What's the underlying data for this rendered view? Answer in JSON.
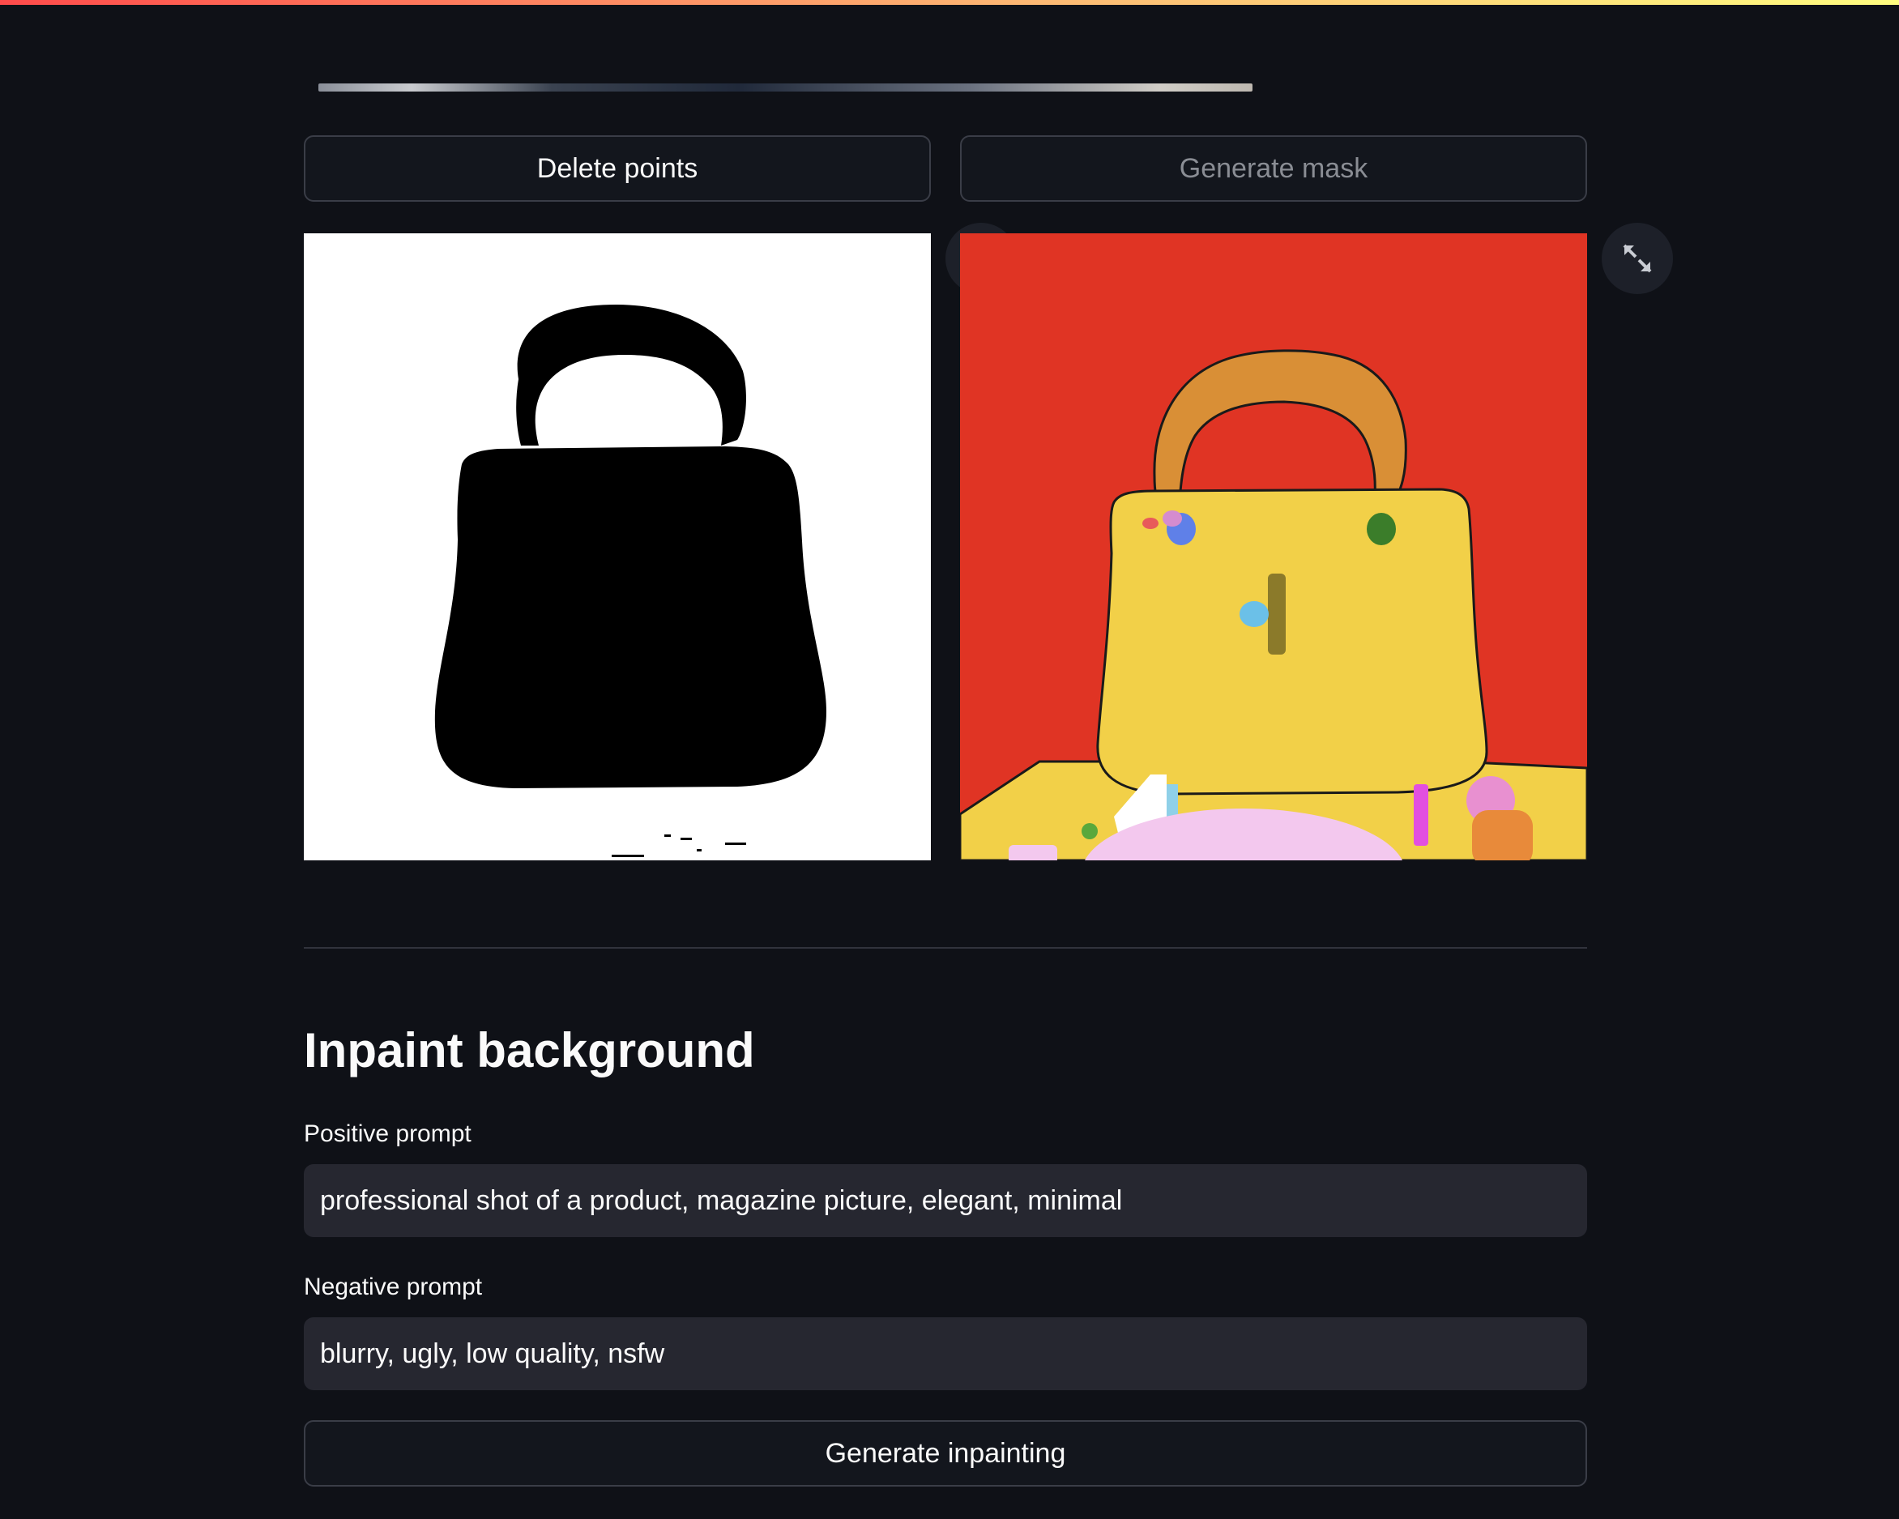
{
  "buttons": {
    "delete_points": "Delete points",
    "generate_mask": "Generate mask",
    "generate_inpainting": "Generate inpainting"
  },
  "images": {
    "mask": {
      "description": "black handbag silhouette mask"
    },
    "segmentation": {
      "description": "colored segmentation map"
    }
  },
  "inpaint": {
    "title": "Inpaint background",
    "positive_label": "Positive prompt",
    "positive_value": "professional shot of a product, magazine picture, elegant, minimal",
    "negative_label": "Negative prompt",
    "negative_value": "blurry, ugly, low quality, nsfw"
  },
  "icons": {
    "expand": "expand-icon"
  },
  "colors": {
    "background": "#0f1117",
    "button_bg": "#13161d",
    "input_bg": "#262730",
    "segmentation_background": "#e03424",
    "segmentation_bag": "#f2d048",
    "segmentation_handle": "#d98f36"
  }
}
